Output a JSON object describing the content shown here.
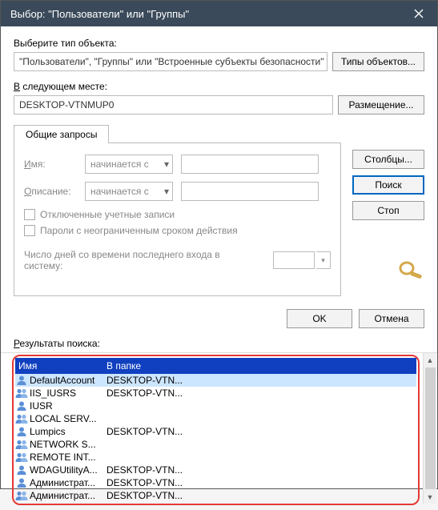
{
  "titlebar": {
    "text": "Выбор: \"Пользователи\" или \"Группы\""
  },
  "labels": {
    "object_type": "Выберите тип объекта:",
    "location": "В следующем месте:",
    "tab": "Общие запросы",
    "name": "Имя:",
    "description": "Описание:",
    "disabled": "Отключенные учетные записи",
    "non_expiring": "Пароли с неограниченным сроком действия",
    "days_since": "Число дней со времени последнего входа в систему:",
    "results": "Результаты поиска:",
    "col_name": "Имя",
    "col_folder": "В папке",
    "starts_with": "начинается с"
  },
  "values": {
    "object_type": "\"Пользователи\", \"Группы\" или \"Встроенные субъекты безопасности\"",
    "location": "DESKTOP-VTNMUP0"
  },
  "buttons": {
    "object_types": "Типы объектов...",
    "locations": "Размещение...",
    "columns": "Столбцы...",
    "search": "Поиск",
    "stop": "Стоп",
    "ok": "OK",
    "cancel": "Отмена"
  },
  "results": [
    {
      "icon": "user",
      "name": "DefaultAccount",
      "folder": "DESKTOP-VTN...",
      "selected": true
    },
    {
      "icon": "group",
      "name": "IIS_IUSRS",
      "folder": "DESKTOP-VTN..."
    },
    {
      "icon": "user",
      "name": "IUSR",
      "folder": ""
    },
    {
      "icon": "group",
      "name": "LOCAL SERV...",
      "folder": ""
    },
    {
      "icon": "user",
      "name": "Lumpics",
      "folder": "DESKTOP-VTN..."
    },
    {
      "icon": "group",
      "name": "NETWORK S...",
      "folder": ""
    },
    {
      "icon": "group",
      "name": "REMOTE INT...",
      "folder": ""
    },
    {
      "icon": "user",
      "name": "WDAGUtilityA...",
      "folder": "DESKTOP-VTN..."
    },
    {
      "icon": "user",
      "name": "Администрат...",
      "folder": "DESKTOP-VTN..."
    },
    {
      "icon": "group",
      "name": "Администрат...",
      "folder": "DESKTOP-VTN..."
    }
  ]
}
